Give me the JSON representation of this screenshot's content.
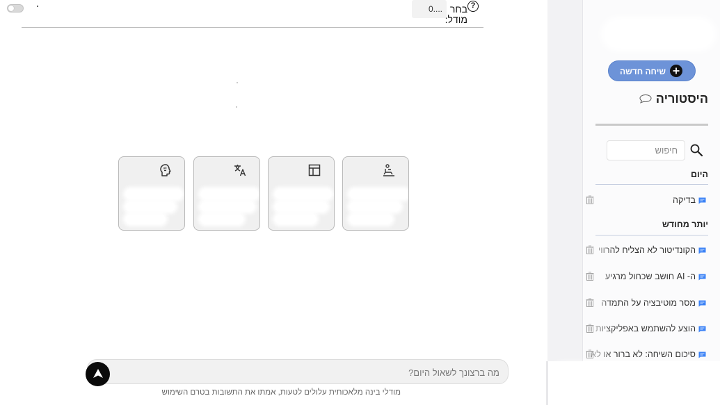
{
  "header": {
    "model_value": "0....",
    "model_label": "בחר מודל:",
    "help_glyph": "?"
  },
  "cards": [
    {
      "icon": "chair-icon"
    },
    {
      "icon": "table-icon"
    },
    {
      "icon": "translate-icon"
    },
    {
      "icon": "brain-head-icon"
    }
  ],
  "chat": {
    "placeholder": "מה ברצונך לשאול היום?",
    "disclaimer": "מודלי בינה מלאכותית עלולים לטעות, אמתו את התשובות בטרם השימוש"
  },
  "sidebar": {
    "new_chat_label": "שיחה חדשה",
    "history_title": "היסטוריה",
    "search_placeholder": "חיפוש",
    "sections": [
      {
        "label": "היום",
        "items": [
          "בדיקה"
        ]
      },
      {
        "label": "יותר מחודש",
        "items": [
          "הקונדיטור לא הצליח להרווי",
          "ה- AI חושב שכחול מרגיע",
          "מסר מוטיבציה על התמדה",
          "הוצע להשתמש באפליקציות",
          "סיכום השיחה: לא ברור או לא"
        ]
      }
    ]
  },
  "colors": {
    "accent": "#6d93d8",
    "message_icon": "#3b82f6",
    "send_button": "#0a0a0a"
  }
}
